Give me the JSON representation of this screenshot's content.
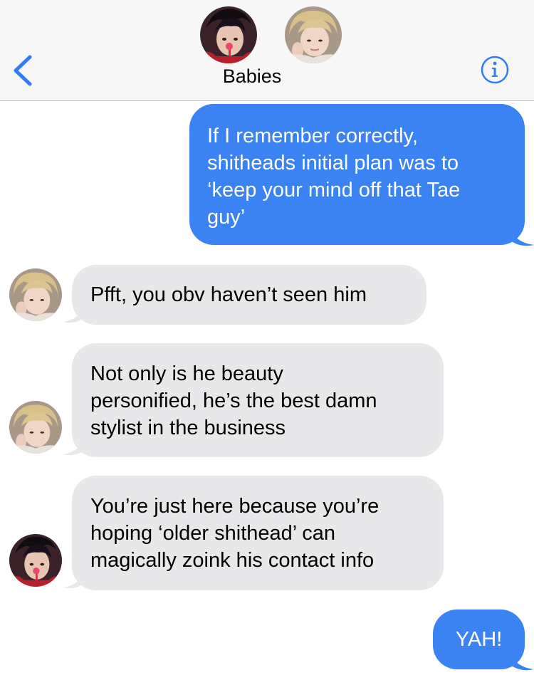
{
  "header": {
    "title": "Babies",
    "back_icon": "chevron-left-icon",
    "info_icon": "info-icon",
    "accent": "#2f7cf6"
  },
  "messages": [
    {
      "sender": "me",
      "lines": [
        "If I remember correctly,",
        "shitheads initial plan was to",
        "‘keep your mind off that Tae",
        "guy’"
      ]
    },
    {
      "sender": "contact-blonde",
      "lines": [
        "Pfft, you obv haven’t seen him"
      ]
    },
    {
      "sender": "contact-blonde",
      "lines": [
        "Not only is he beauty",
        "personified, he’s the best damn",
        "stylist in the business"
      ]
    },
    {
      "sender": "contact-dark",
      "lines": [
        "You’re just here because you’re",
        "hoping ‘older shithead’ can",
        "magically zoink his contact info"
      ]
    },
    {
      "sender": "me",
      "lines": [
        "YAH!"
      ]
    }
  ],
  "colors": {
    "outgoing": "#3b82f2",
    "incoming": "#e8e8ea"
  }
}
